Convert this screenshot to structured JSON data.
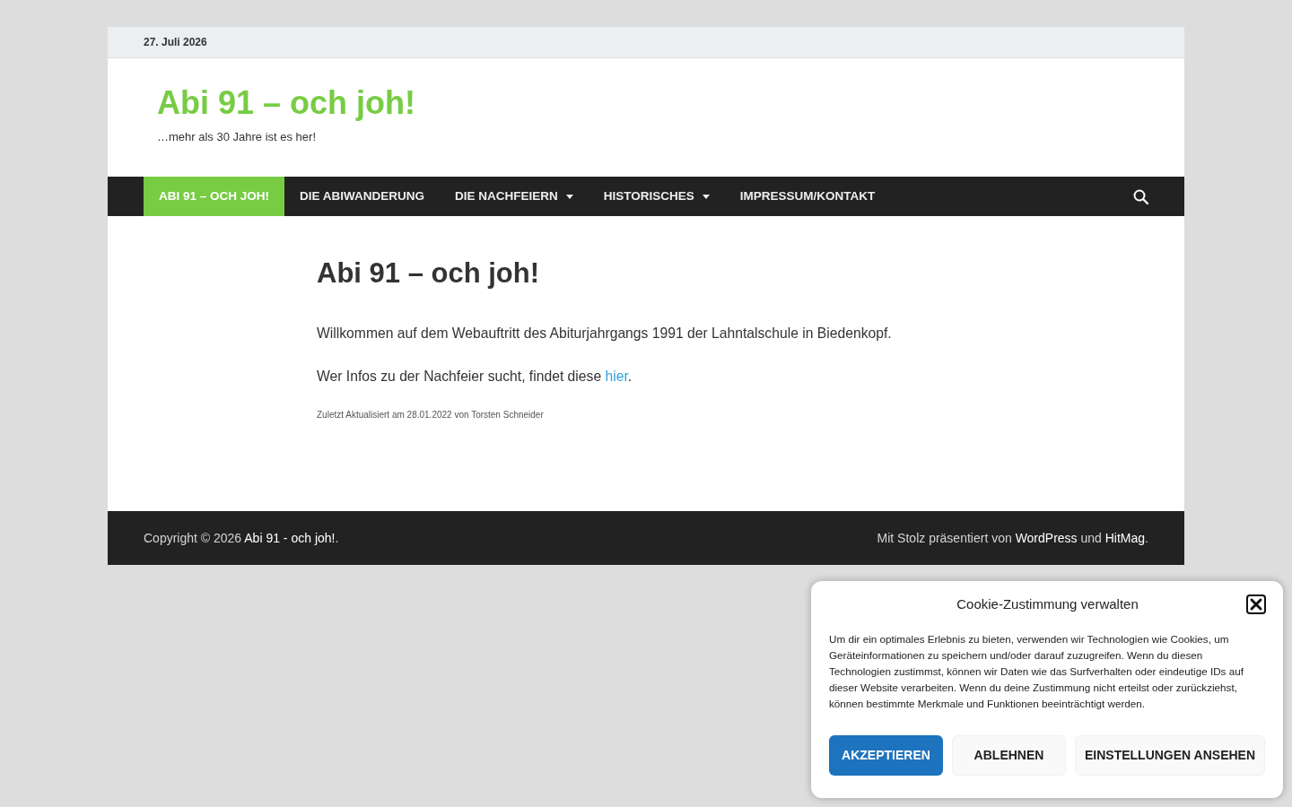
{
  "top_bar": {
    "date": "27. Juli 2026"
  },
  "header": {
    "site_title": "Abi 91 – och joh!",
    "tagline": "…mehr als 30 Jahre ist es her!"
  },
  "nav": {
    "items": [
      {
        "label": "ABI 91 – OCH JOH!",
        "selected": true,
        "has_submenu": false
      },
      {
        "label": "DIE ABIWANDERUNG",
        "selected": false,
        "has_submenu": false
      },
      {
        "label": "DIE NACHFEIERN",
        "selected": false,
        "has_submenu": true
      },
      {
        "label": "HISTORISCHES",
        "selected": false,
        "has_submenu": true
      },
      {
        "label": "IMPRESSUM/KONTAKT",
        "selected": false,
        "has_submenu": false
      }
    ]
  },
  "content": {
    "title": "Abi 91 – och joh!",
    "paragraphs": [
      [
        {
          "kind": "text",
          "text": "Willkommen auf dem Webauftritt des Abiturjahrgangs 1991 der Lahntalschule in Biedenkopf."
        }
      ],
      [
        {
          "kind": "text",
          "text": "Wer Infos zu der Nachfeier sucht, findet diese "
        },
        {
          "kind": "link",
          "text": "hier"
        },
        {
          "kind": "text",
          "text": "."
        }
      ]
    ],
    "meta": "Zuletzt Aktualisiert am 28.01.2022 von Torsten Schneider"
  },
  "footer": {
    "copyright": [
      {
        "kind": "text",
        "text": "Copyright © 2026 "
      },
      {
        "kind": "link",
        "text": "Abi 91 - och joh!"
      },
      {
        "kind": "text",
        "text": "."
      }
    ],
    "credits": [
      {
        "kind": "text",
        "text": "Mit Stolz präsentiert von "
      },
      {
        "kind": "link",
        "text": "WordPress"
      },
      {
        "kind": "text",
        "text": " und "
      },
      {
        "kind": "link",
        "text": "HitMag"
      },
      {
        "kind": "text",
        "text": "."
      }
    ]
  },
  "cookie_banner": {
    "title": "Cookie-Zustimmung verwalten",
    "text": "Um dir ein optimales Erlebnis zu bieten, verwenden wir Technologien wie Cookies, um Geräteinformationen zu speichern und/oder darauf zuzugreifen. Wenn du diesen Technologien zustimmst, können wir Daten wie das Surfverhalten oder eindeutige IDs auf dieser Website verarbeiten. Wenn du deine Zustimmung nicht erteilst oder zurückziehst, können bestimmte Merkmale und Funktionen beeinträchtigt werden.",
    "buttons": [
      {
        "label": "AKZEPTIEREN",
        "kind": "primary"
      },
      {
        "label": "ABLEHNEN",
        "kind": "secondary"
      },
      {
        "label": "EINSTELLUNGEN ANSEHEN",
        "kind": "secondary"
      }
    ]
  }
}
